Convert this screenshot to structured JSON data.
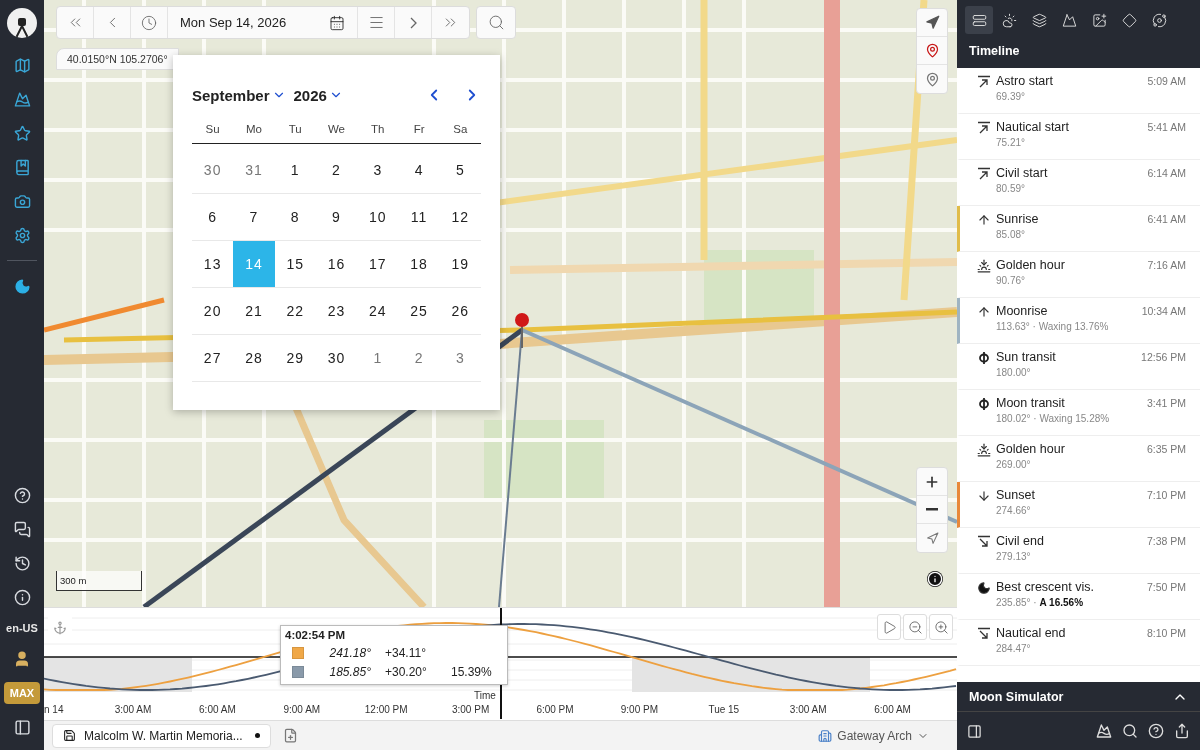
{
  "sidebar": {
    "locale": "en-US",
    "plan_badge": "MAX"
  },
  "toolbar": {
    "date": "Mon Sep 14, 2026"
  },
  "map": {
    "coordinates": "40.0150°N 105.2706°",
    "scale": "300 m"
  },
  "calendar": {
    "month": "September",
    "year": "2026",
    "weekdays": [
      "Su",
      "Mo",
      "Tu",
      "We",
      "Th",
      "Fr",
      "Sa"
    ],
    "weeks": [
      [
        {
          "label": "30",
          "outside": true,
          "selected": false
        },
        {
          "label": "31",
          "outside": true,
          "selected": false
        },
        {
          "label": "1",
          "outside": false,
          "selected": false
        },
        {
          "label": "2",
          "outside": false,
          "selected": false
        },
        {
          "label": "3",
          "outside": false,
          "selected": false
        },
        {
          "label": "4",
          "outside": false,
          "selected": false
        },
        {
          "label": "5",
          "outside": false,
          "selected": false
        }
      ],
      [
        {
          "label": "6",
          "outside": false,
          "selected": false
        },
        {
          "label": "7",
          "outside": false,
          "selected": false
        },
        {
          "label": "8",
          "outside": false,
          "selected": false
        },
        {
          "label": "9",
          "outside": false,
          "selected": false
        },
        {
          "label": "10",
          "outside": false,
          "selected": false
        },
        {
          "label": "11",
          "outside": false,
          "selected": false
        },
        {
          "label": "12",
          "outside": false,
          "selected": false
        }
      ],
      [
        {
          "label": "13",
          "outside": false,
          "selected": false
        },
        {
          "label": "14",
          "outside": false,
          "selected": true
        },
        {
          "label": "15",
          "outside": false,
          "selected": false
        },
        {
          "label": "16",
          "outside": false,
          "selected": false
        },
        {
          "label": "17",
          "outside": false,
          "selected": false
        },
        {
          "label": "18",
          "outside": false,
          "selected": false
        },
        {
          "label": "19",
          "outside": false,
          "selected": false
        }
      ],
      [
        {
          "label": "20",
          "outside": false,
          "selected": false
        },
        {
          "label": "21",
          "outside": false,
          "selected": false
        },
        {
          "label": "22",
          "outside": false,
          "selected": false
        },
        {
          "label": "23",
          "outside": false,
          "selected": false
        },
        {
          "label": "24",
          "outside": false,
          "selected": false
        },
        {
          "label": "25",
          "outside": false,
          "selected": false
        },
        {
          "label": "26",
          "outside": false,
          "selected": false
        }
      ],
      [
        {
          "label": "27",
          "outside": false,
          "selected": false
        },
        {
          "label": "28",
          "outside": false,
          "selected": false
        },
        {
          "label": "29",
          "outside": false,
          "selected": false
        },
        {
          "label": "30",
          "outside": false,
          "selected": false
        },
        {
          "label": "1",
          "outside": true,
          "selected": false
        },
        {
          "label": "2",
          "outside": true,
          "selected": false
        },
        {
          "label": "3",
          "outside": true,
          "selected": false
        }
      ]
    ]
  },
  "panel": {
    "tabs": [
      {
        "selected": true
      },
      {
        "selected": false
      },
      {
        "selected": false
      },
      {
        "selected": false
      },
      {
        "selected": false
      },
      {
        "selected": false
      },
      {
        "selected": false
      }
    ],
    "title": "Timeline",
    "events": [
      {
        "kind": "start",
        "name": "Astro start",
        "detail": "69.39°",
        "time": "5:09 AM"
      },
      {
        "kind": "start",
        "name": "Nautical start",
        "detail": "75.21°",
        "time": "5:41 AM"
      },
      {
        "kind": "start",
        "name": "Civil start",
        "detail": "80.59°",
        "time": "6:14 AM"
      },
      {
        "kind": "rise",
        "name": "Sunrise",
        "detail": "85.08°",
        "time": "6:41 AM",
        "color": "#e0bc4a"
      },
      {
        "kind": "golden",
        "name": "Golden hour",
        "detail": "90.76°",
        "time": "7:16 AM"
      },
      {
        "kind": "rise",
        "name": "Moonrise",
        "detail": "113.63° · Waxing 13.76%",
        "time": "10:34 AM",
        "color": "#9fb4c2"
      },
      {
        "kind": "transit",
        "name": "Sun transit",
        "detail": "180.00°",
        "time": "12:56 PM"
      },
      {
        "kind": "transit",
        "name": "Moon transit",
        "detail": "180.02° · Waxing 15.28%",
        "time": "3:41 PM"
      },
      {
        "kind": "golden",
        "name": "Golden hour",
        "detail": "269.00°",
        "time": "6:35 PM"
      },
      {
        "kind": "set",
        "name": "Sunset",
        "detail": "274.66°",
        "time": "7:10 PM",
        "color": "#e8883a"
      },
      {
        "kind": "end",
        "name": "Civil end",
        "detail": "279.13°",
        "time": "7:38 PM"
      },
      {
        "kind": "crescent",
        "name": "Best crescent vis.",
        "detail": "235.85° · **A 16.56%**",
        "time": "7:50 PM"
      },
      {
        "kind": "end",
        "name": "Nautical end",
        "detail": "284.47°",
        "time": "8:10 PM"
      }
    ],
    "simulator": {
      "title": "Moon Simulator"
    }
  },
  "timeline": {
    "axis_title": "Time",
    "axis_labels": [
      "n 14",
      "3:00 AM",
      "6:00 AM",
      "9:00 AM",
      "12:00 PM",
      "3:00 PM",
      "6:00 PM",
      "9:00 PM",
      "Tue 15",
      "3:00 AM",
      "6:00 AM"
    ],
    "tooltip": {
      "time": "4:02:54 PM",
      "rows": [
        {
          "color": "#f0a848",
          "azimuth": "241.18°",
          "altitude": "+34.11°"
        },
        {
          "color": "#8a9aaa",
          "azimuth": "185.85°",
          "altitude": "+30.20°",
          "phase": "15.39%"
        }
      ]
    }
  },
  "bottom_bar": {
    "document": {
      "title": "Malcolm W. Martin Memoria...",
      "modified": true
    },
    "location": "Gateway Arch"
  }
}
